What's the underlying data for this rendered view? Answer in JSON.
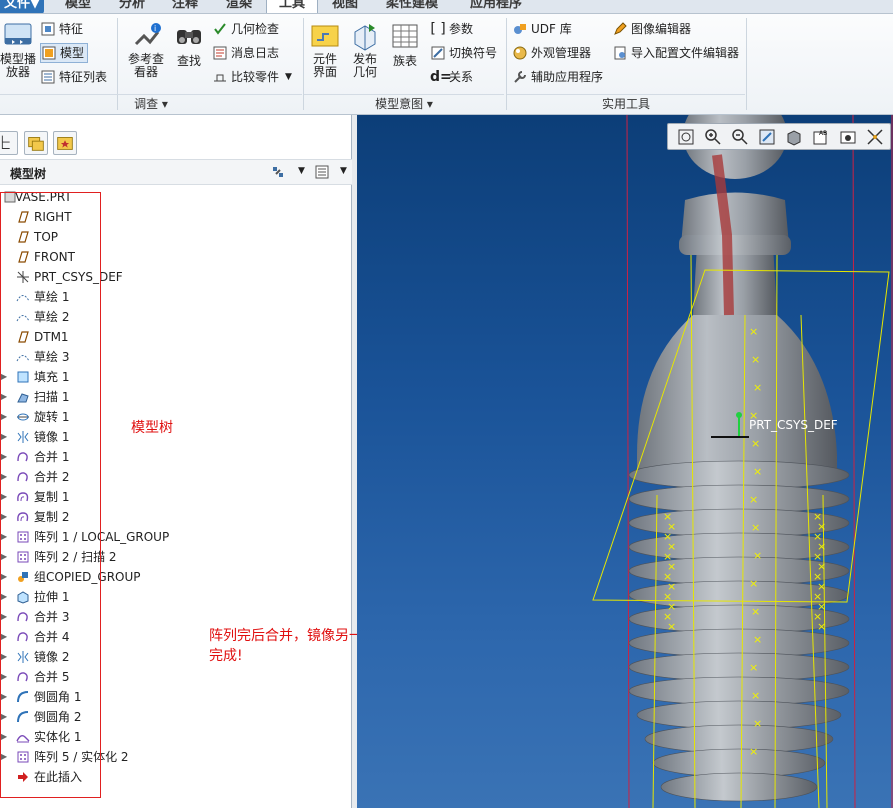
{
  "ribbon": {
    "tabs": [
      {
        "label": "文件▼"
      },
      {
        "label": "模型"
      },
      {
        "label": "分析"
      },
      {
        "label": "注释"
      },
      {
        "label": "渲染"
      },
      {
        "label": "工具"
      },
      {
        "label": "视图"
      },
      {
        "label": "柔性建模"
      },
      {
        "label": "应用程序"
      }
    ],
    "investigate": {
      "model_player": "模型播\n放器",
      "feature": "特征",
      "model": "模型",
      "feature_list": "特征列表",
      "reference_viewer": "参考查\n看器",
      "find": "查找",
      "geometry_check": "几何检查",
      "message_log": "消息日志",
      "compare_part": "比较零件",
      "group_label": "调查 ▾"
    },
    "model_intent": {
      "component_interface": "元件\n界面",
      "publish_geometry": "发布\n几何",
      "family_table": "族表",
      "parameters": "参数",
      "switch_symbols": "切换符号",
      "relations": "关系",
      "group_label": "模型意图 ▾"
    },
    "utilities": {
      "udf_library": "UDF 库",
      "appearance_manager": "外观管理器",
      "auxiliary_apps": "辅助应用程序",
      "image_editor": "图像编辑器",
      "import_config_editor": "导入配置文件编辑器",
      "group_label": "实用工具"
    }
  },
  "model_tree": {
    "title": "模型树",
    "root": "VASE.PRT",
    "items": [
      {
        "label": "RIGHT",
        "icon": "datum-plane-icon",
        "expandable": false
      },
      {
        "label": "TOP",
        "icon": "datum-plane-icon",
        "expandable": false
      },
      {
        "label": "FRONT",
        "icon": "datum-plane-icon",
        "expandable": false
      },
      {
        "label": "PRT_CSYS_DEF",
        "icon": "csys-icon",
        "expandable": false
      },
      {
        "label": "草绘 1",
        "icon": "sketch-icon",
        "expandable": false
      },
      {
        "label": "草绘 2",
        "icon": "sketch-icon",
        "expandable": false
      },
      {
        "label": "DTM1",
        "icon": "datum-plane-icon",
        "expandable": false
      },
      {
        "label": "草绘 3",
        "icon": "sketch-icon",
        "expandable": false
      },
      {
        "label": "填充 1",
        "icon": "fill-icon",
        "expandable": true
      },
      {
        "label": "扫描 1",
        "icon": "sweep-icon",
        "expandable": true
      },
      {
        "label": "旋转 1",
        "icon": "revolve-icon",
        "expandable": true
      },
      {
        "label": "镜像 1",
        "icon": "mirror-icon",
        "expandable": true
      },
      {
        "label": "合并 1",
        "icon": "merge-icon",
        "expandable": true
      },
      {
        "label": "合并 2",
        "icon": "merge-icon",
        "expandable": true
      },
      {
        "label": "复制 1",
        "icon": "copy-icon",
        "expandable": true
      },
      {
        "label": "复制 2",
        "icon": "copy-icon",
        "expandable": true
      },
      {
        "label": "阵列 1 / LOCAL_GROUP",
        "icon": "pattern-icon",
        "expandable": true
      },
      {
        "label": "阵列 2 / 扫描 2",
        "icon": "pattern-icon",
        "expandable": true
      },
      {
        "label": "组COPIED_GROUP",
        "icon": "group-icon",
        "expandable": true
      },
      {
        "label": "拉伸 1",
        "icon": "extrude-icon",
        "expandable": true
      },
      {
        "label": "合并 3",
        "icon": "merge-icon",
        "expandable": true
      },
      {
        "label": "合并 4",
        "icon": "merge-icon",
        "expandable": true
      },
      {
        "label": "镜像 2",
        "icon": "mirror-icon",
        "expandable": true
      },
      {
        "label": "合并 5",
        "icon": "merge-icon",
        "expandable": true
      },
      {
        "label": "倒圆角 1",
        "icon": "round-icon",
        "expandable": true
      },
      {
        "label": "倒圆角 2",
        "icon": "round-icon",
        "expandable": true
      },
      {
        "label": "实体化 1",
        "icon": "solidify-icon",
        "expandable": true
      },
      {
        "label": "阵列 5 / 实体化 2",
        "icon": "pattern-icon",
        "expandable": true
      },
      {
        "label": "在此插入",
        "icon": "insert-here-arrow-icon",
        "expandable": false
      }
    ]
  },
  "annotations": {
    "tree_note": "模型树",
    "process_note_line1": "阵列完后合并，镜像另一半，再实体化",
    "process_note_line2": "完成!"
  },
  "viewport": {
    "csys_label": "PRT_CSYS_DEF",
    "bg_top": "#0c3e78",
    "bg_bottom": "#3a73b5"
  },
  "colors": {
    "accent": "#2f73b8",
    "annotation": "#e01010",
    "datum": "#ffff00"
  }
}
